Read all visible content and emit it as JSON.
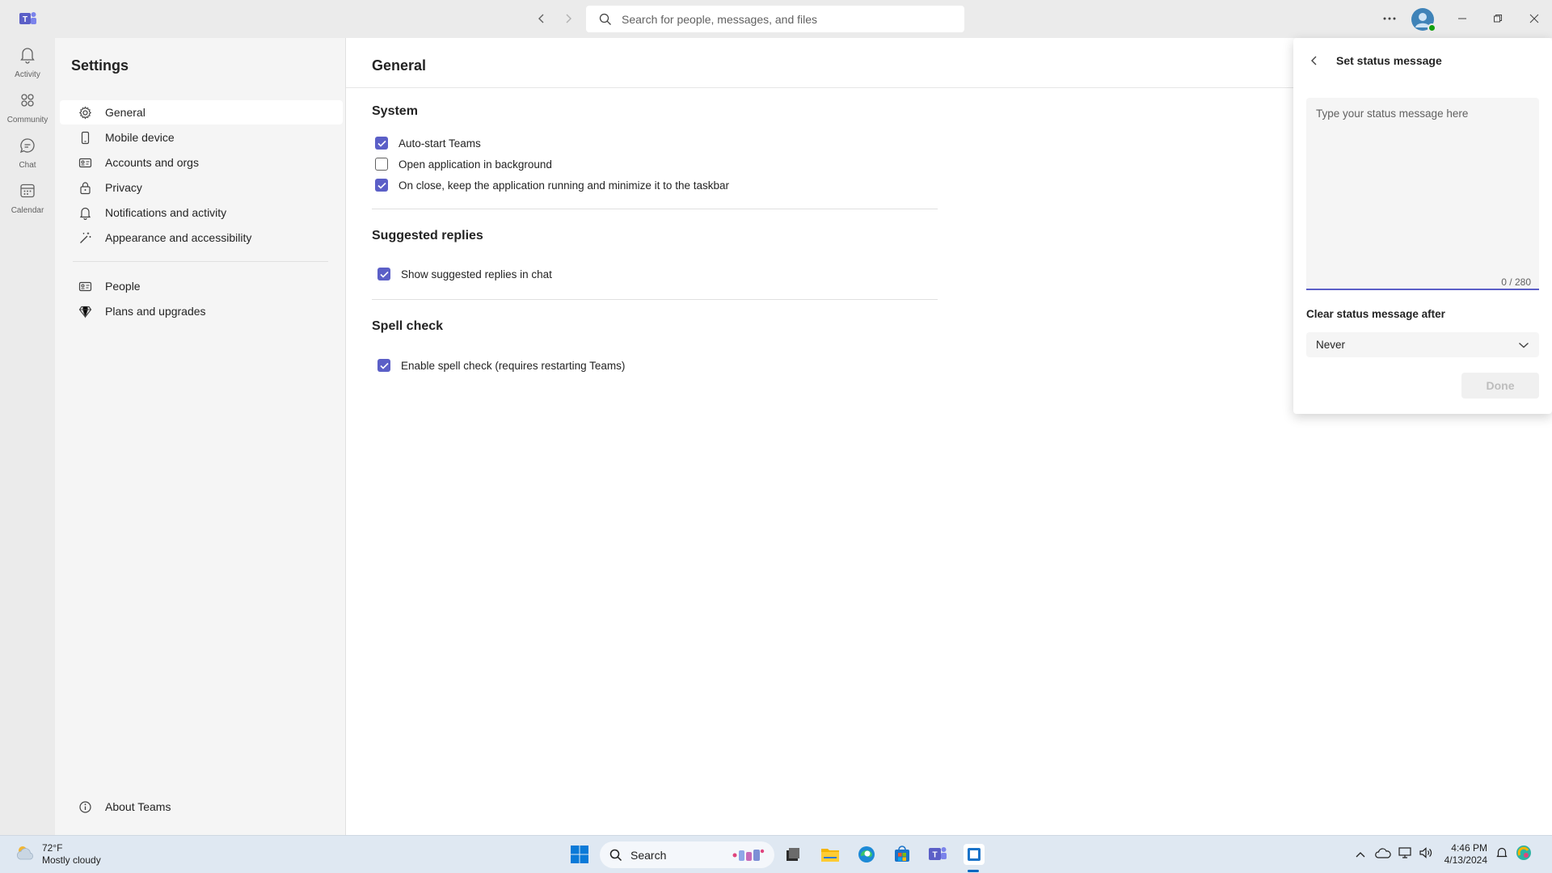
{
  "titlebar": {
    "search_placeholder": "Search for people, messages, and files"
  },
  "rail": {
    "items": [
      {
        "label": "Activity",
        "icon": "bell-icon"
      },
      {
        "label": "Community",
        "icon": "community-icon"
      },
      {
        "label": "Chat",
        "icon": "chat-icon"
      },
      {
        "label": "Calendar",
        "icon": "calendar-icon"
      }
    ]
  },
  "sidebar": {
    "title": "Settings",
    "items": [
      {
        "label": "General",
        "icon": "gear-icon",
        "active": true
      },
      {
        "label": "Mobile device",
        "icon": "phone-icon"
      },
      {
        "label": "Accounts and orgs",
        "icon": "id-card-icon"
      },
      {
        "label": "Privacy",
        "icon": "lock-icon"
      },
      {
        "label": "Notifications and activity",
        "icon": "bell-icon"
      },
      {
        "label": "Appearance and accessibility",
        "icon": "wand-icon"
      },
      {
        "label": "People",
        "icon": "contact-card-icon"
      },
      {
        "label": "Plans and upgrades",
        "icon": "diamond-icon"
      }
    ],
    "about_label": "About Teams"
  },
  "main": {
    "title": "General",
    "sections": {
      "system": {
        "title": "System",
        "options": [
          {
            "label": "Auto-start Teams",
            "checked": true
          },
          {
            "label": "Open application in background",
            "checked": false
          },
          {
            "label": "On close, keep the application running and minimize it to the taskbar",
            "checked": true
          }
        ]
      },
      "suggested": {
        "title": "Suggested replies",
        "options": [
          {
            "label": "Show suggested replies in chat",
            "checked": true
          }
        ]
      },
      "spell": {
        "title": "Spell check",
        "options": [
          {
            "label": "Enable spell check (requires restarting Teams)",
            "checked": true
          }
        ]
      }
    }
  },
  "status_panel": {
    "title": "Set status message",
    "placeholder": "Type your status message here",
    "counter": "0 / 280",
    "clear_label": "Clear status message after",
    "clear_value": "Never",
    "done_label": "Done"
  },
  "taskbar": {
    "weather_temp": "72°F",
    "weather_desc": "Mostly cloudy",
    "search_label": "Search",
    "time": "4:46 PM",
    "date": "4/13/2024"
  },
  "colors": {
    "accent": "#5b5fc7",
    "rail_bg": "#ebebeb",
    "sidebar_bg": "#f5f5f5",
    "taskbar_bg": "#dfe8f2"
  }
}
